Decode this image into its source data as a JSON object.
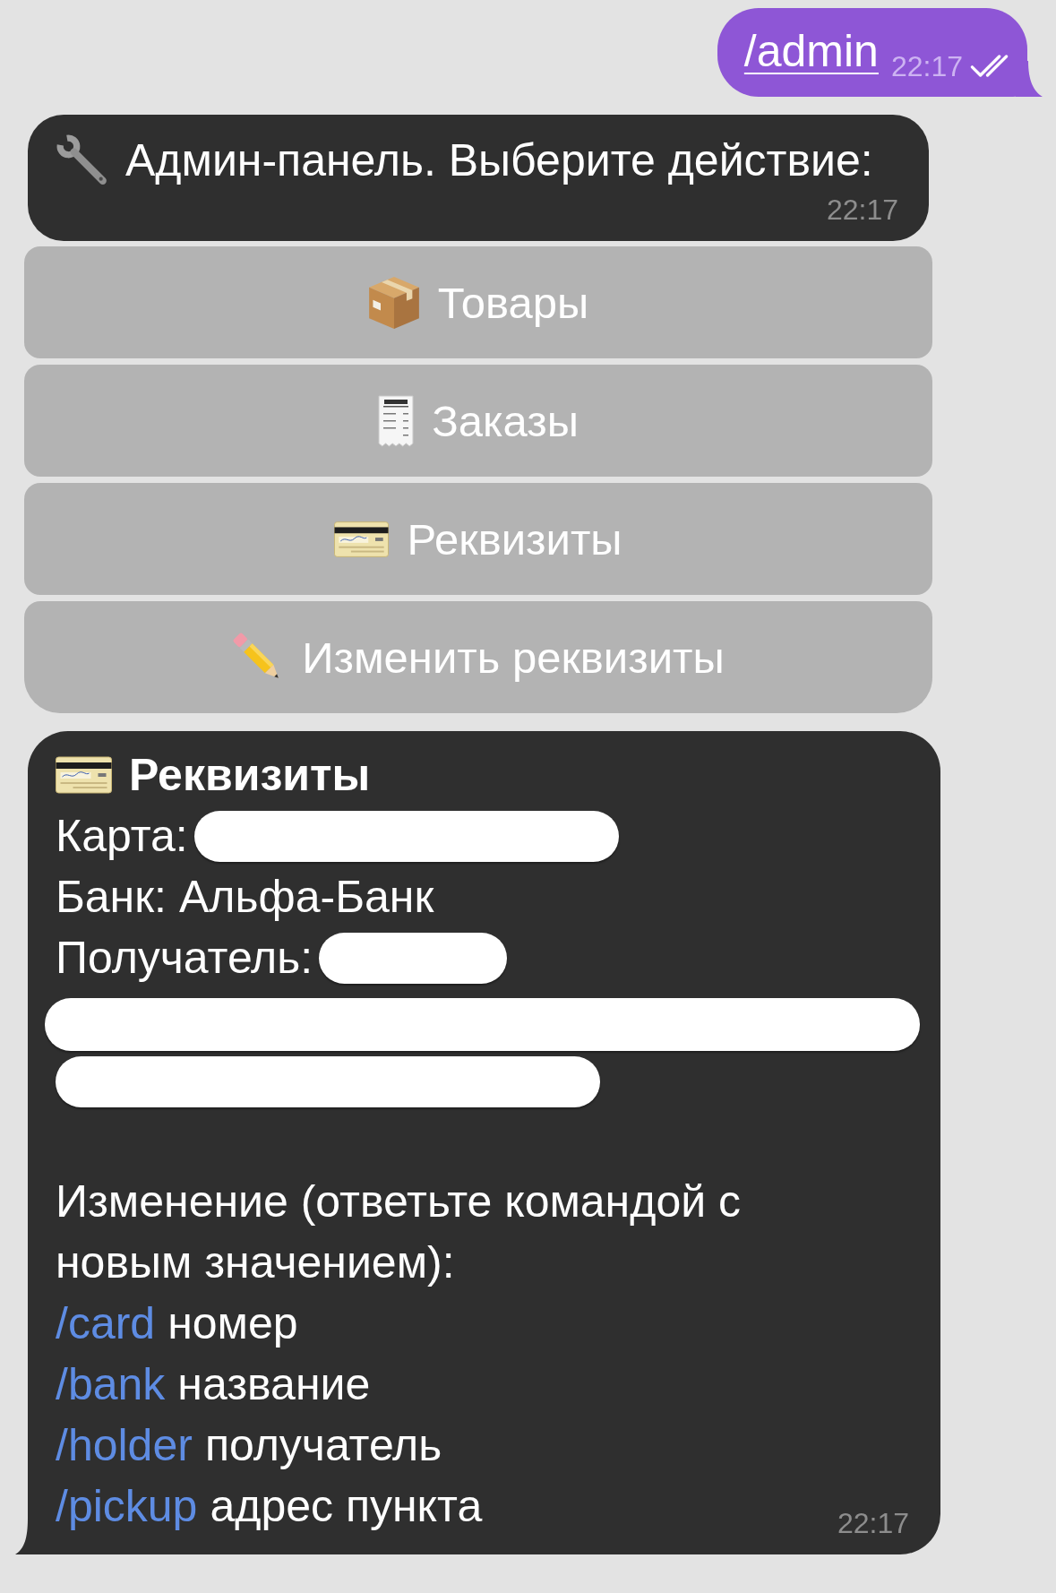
{
  "outgoing": {
    "text": "/admin",
    "time": "22:17",
    "read": true
  },
  "admin_message": {
    "text": "Админ-панель. Выберите действие:",
    "time": "22:17"
  },
  "keyboard": [
    {
      "label": "Товары"
    },
    {
      "label": "Заказы"
    },
    {
      "label": "Реквизиты"
    },
    {
      "label": "Изменить реквизиты"
    }
  ],
  "details_message": {
    "title": "Реквизиты",
    "lines": [
      {
        "kind": "field",
        "label": "Карта:",
        "redacted": true
      },
      {
        "kind": "field",
        "label": "Банк:",
        "value": "Альфа-Банк",
        "redacted": false
      },
      {
        "kind": "field",
        "label": "Получатель:",
        "redacted": true
      },
      {
        "kind": "redacted"
      },
      {
        "kind": "redacted"
      }
    ],
    "intro": "Изменение (ответьте командой с новым значением):",
    "commands": [
      {
        "command": "/card",
        "description": "номер"
      },
      {
        "command": "/bank",
        "description": "название"
      },
      {
        "command": "/holder",
        "description": "получатель"
      },
      {
        "command": "/pickup",
        "description": "адрес пункта"
      }
    ],
    "time": "22:17"
  }
}
